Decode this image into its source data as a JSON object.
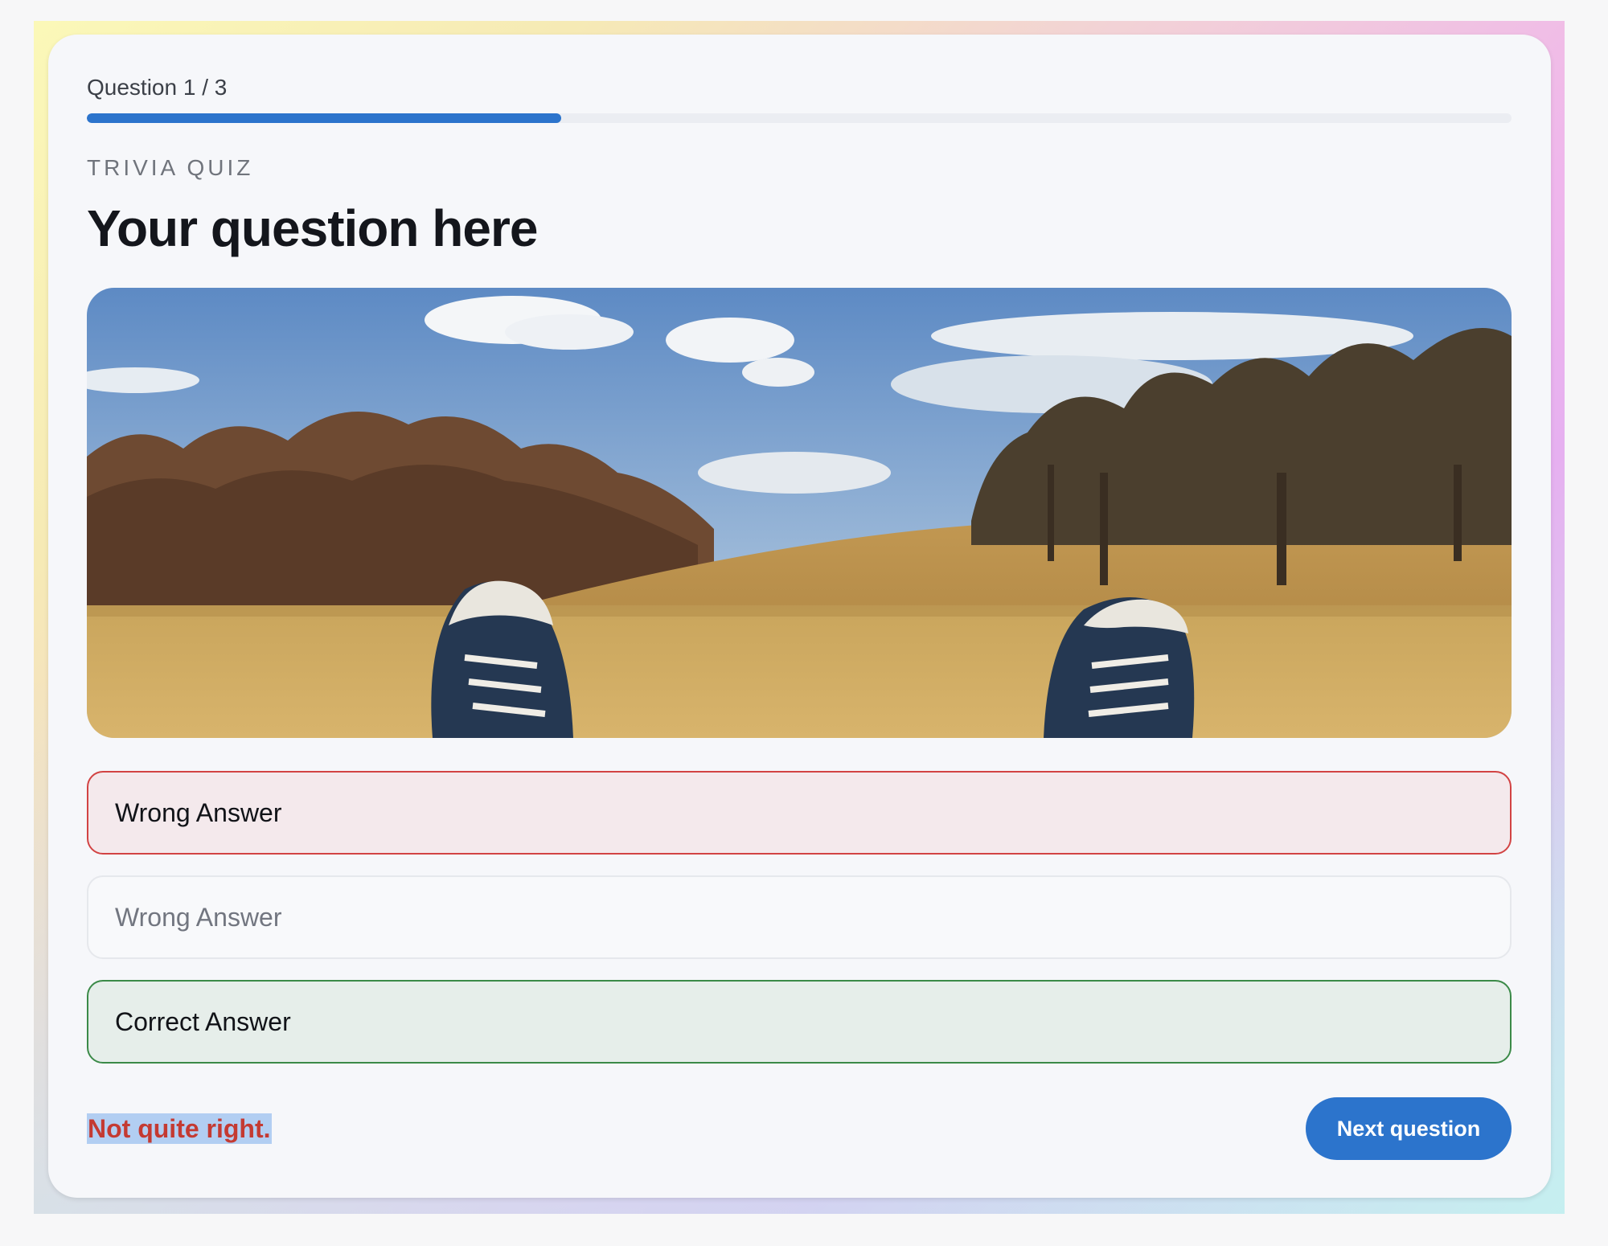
{
  "progress": {
    "label": "Question 1 / 3",
    "fraction": 0.333
  },
  "quiz": {
    "eyebrow": "TRIVIA QUIZ",
    "question": "Your question here",
    "image_icon": "landscape-photo-park-sneakers"
  },
  "answers": [
    {
      "label": "Wrong Answer",
      "state": "selected-wrong"
    },
    {
      "label": "Wrong Answer",
      "state": "neutral"
    },
    {
      "label": "Correct Answer",
      "state": "correct"
    }
  ],
  "feedback": "Not quite right.",
  "next_button": "Next question",
  "colors": {
    "accent": "#2c74cc",
    "wrong": "#d24343",
    "correct": "#3b8a48",
    "feedback": "#c43a32"
  }
}
